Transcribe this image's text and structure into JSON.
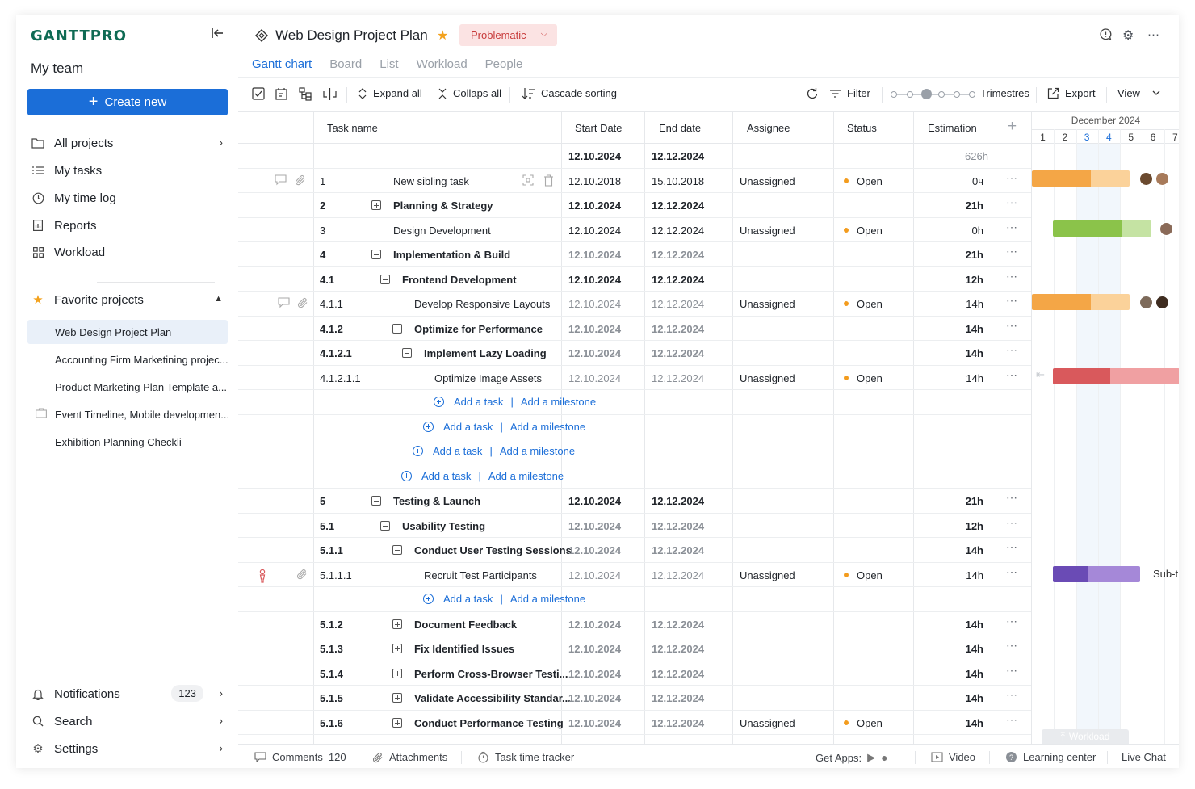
{
  "app": {
    "logo": "GANTTPRO"
  },
  "sidebar": {
    "team": "My team",
    "create_label": "Create new",
    "nav": [
      {
        "label": "All projects",
        "icon": "folder-icon"
      },
      {
        "label": "My tasks",
        "icon": "list-icon"
      },
      {
        "label": "My time log",
        "icon": "clock-icon"
      },
      {
        "label": "Reports",
        "icon": "report-icon"
      },
      {
        "label": "Workload",
        "icon": "grid-icon"
      }
    ],
    "favorites_label": "Favorite projects",
    "favorites": [
      "Web Design Project Plan",
      "Accounting Firm Marketining projec...",
      "Product Marketing Plan Template a...",
      "Event Timeline, Mobile developmen...",
      "Exhibition Planning Checkli"
    ],
    "bottom": [
      {
        "label": "Notifications",
        "count": "123"
      },
      {
        "label": "Search"
      },
      {
        "label": "Settings"
      }
    ]
  },
  "header": {
    "title": "Web Design Project Plan",
    "status": "Problematic",
    "tabs": [
      "Gantt chart",
      "Board",
      "List",
      "Workload",
      "People"
    ]
  },
  "toolbar": {
    "expand": "Expand all",
    "collapse": "Collaps all",
    "cascade": "Cascade sorting",
    "filter": "Filter",
    "scale": "Trimestres",
    "export": "Export",
    "view": "View"
  },
  "grid": {
    "columns": [
      "Task name",
      "Start Date",
      "End date",
      "Assignee",
      "Status",
      "Estimation"
    ],
    "summary": {
      "start": "12.10.2024",
      "end": "12.12.2024",
      "estimation": "626h"
    },
    "rows": [
      {
        "type": "task",
        "num": "1",
        "name": "New sibling task",
        "start": "12.10.2018",
        "end": "15.10.2018",
        "assignee": "Unassigned",
        "status": "Open",
        "est": "0ч",
        "bold": false,
        "muted": false,
        "level": 0,
        "expand": ""
      },
      {
        "type": "task",
        "num": "2",
        "name": "Planning & Strategy",
        "start": "12.10.2024",
        "end": "12.12.2024",
        "assignee": "",
        "status": "",
        "est": "21h",
        "bold": true,
        "muted": false,
        "level": 0,
        "expand": "plus"
      },
      {
        "type": "task",
        "num": "3",
        "name": "Design Development",
        "start": "12.10.2024",
        "end": "12.12.2024",
        "assignee": "Unassigned",
        "status": "Open",
        "est": "0h",
        "bold": false,
        "muted": false,
        "level": 0,
        "expand": ""
      },
      {
        "type": "task",
        "num": "4",
        "name": "Implementation & Build",
        "start": "12.10.2024",
        "end": "12.12.2024",
        "assignee": "",
        "status": "",
        "est": "21h",
        "bold": true,
        "muted": true,
        "level": 0,
        "expand": "minus"
      },
      {
        "type": "task",
        "num": "4.1",
        "name": "Frontend Development",
        "start": "12.10.2024",
        "end": "12.12.2024",
        "assignee": "",
        "status": "",
        "est": "12h",
        "bold": true,
        "muted": false,
        "level": 1,
        "expand": "minus"
      },
      {
        "type": "task",
        "num": "4.1.1",
        "name": "Develop Responsive Layouts",
        "start": "12.10.2024",
        "end": "12.12.2024",
        "assignee": "Unassigned",
        "status": "Open",
        "est": "14h",
        "bold": false,
        "muted": true,
        "level": 2,
        "expand": ""
      },
      {
        "type": "task",
        "num": "4.1.2",
        "name": "Optimize for Performance",
        "start": "12.10.2024",
        "end": "12.12.2024",
        "assignee": "",
        "status": "",
        "est": "14h",
        "bold": true,
        "muted": true,
        "level": 2,
        "expand": "minus"
      },
      {
        "type": "task",
        "num": "4.1.2.1",
        "name": "Implement Lazy Loading",
        "start": "12.10.2024",
        "end": "12.12.2024",
        "assignee": "",
        "status": "",
        "est": "14h",
        "bold": true,
        "muted": true,
        "level": 3,
        "expand": "minus"
      },
      {
        "type": "task",
        "num": "4.1.2.1.1",
        "name": "Optimize Image Assets",
        "start": "12.10.2024",
        "end": "12.12.2024",
        "assignee": "Unassigned",
        "status": "Open",
        "est": "14h",
        "bold": false,
        "muted": true,
        "level": 4,
        "expand": ""
      },
      {
        "type": "add",
        "level": 4
      },
      {
        "type": "add",
        "level": 3
      },
      {
        "type": "add",
        "level": 2
      },
      {
        "type": "add",
        "level": 1
      },
      {
        "type": "task",
        "num": "5",
        "name": "Testing & Launch",
        "start": "12.10.2024",
        "end": "12.12.2024",
        "assignee": "",
        "status": "",
        "est": "21h",
        "bold": true,
        "muted": false,
        "level": 0,
        "expand": "minus"
      },
      {
        "type": "task",
        "num": "5.1",
        "name": "Usability Testing",
        "start": "12.10.2024",
        "end": "12.12.2024",
        "assignee": "",
        "status": "",
        "est": "12h",
        "bold": true,
        "muted": true,
        "level": 1,
        "expand": "minus"
      },
      {
        "type": "task",
        "num": "5.1.1",
        "name": "Conduct User Testing Sessions",
        "start": "12.10.2024",
        "end": "12.12.2024",
        "assignee": "",
        "status": "",
        "est": "14h",
        "bold": true,
        "muted": true,
        "level": 2,
        "expand": "minus"
      },
      {
        "type": "task",
        "num": "5.1.1.1",
        "name": "Recruit Test Participants",
        "start": "12.10.2024",
        "end": "12.12.2024",
        "assignee": "Unassigned",
        "status": "Open",
        "est": "14h",
        "bold": false,
        "muted": true,
        "level": 3,
        "expand": ""
      },
      {
        "type": "add",
        "level": 3
      },
      {
        "type": "task",
        "num": "5.1.2",
        "name": "Document Feedback",
        "start": "12.10.2024",
        "end": "12.12.2024",
        "assignee": "",
        "status": "",
        "est": "14h",
        "bold": true,
        "muted": true,
        "level": 2,
        "expand": "plus"
      },
      {
        "type": "task",
        "num": "5.1.3",
        "name": "Fix Identified Issues",
        "start": "12.10.2024",
        "end": "12.12.2024",
        "assignee": "",
        "status": "",
        "est": "14h",
        "bold": true,
        "muted": true,
        "level": 2,
        "expand": "plus"
      },
      {
        "type": "task",
        "num": "5.1.4",
        "name": "Perform Cross-Browser Testi...",
        "start": "12.10.2024",
        "end": "12.12.2024",
        "assignee": "",
        "status": "",
        "est": "14h",
        "bold": true,
        "muted": true,
        "level": 2,
        "expand": "plus"
      },
      {
        "type": "task",
        "num": "5.1.5",
        "name": "Validate Accessibility Standar...",
        "start": "12.10.2024",
        "end": "12.12.2024",
        "assignee": "",
        "status": "",
        "est": "14h",
        "bold": true,
        "muted": true,
        "level": 2,
        "expand": "plus"
      },
      {
        "type": "task",
        "num": "5.1.6",
        "name": "Conduct Performance Testing",
        "start": "12.10.2024",
        "end": "12.12.2024",
        "assignee": "Unassigned",
        "status": "Open",
        "est": "14h",
        "bold": true,
        "muted": true,
        "level": 2,
        "expand": "plus"
      }
    ],
    "add_task": "Add a task",
    "add_milestone": "Add a milestone"
  },
  "gantt": {
    "month": "December 2024",
    "days": [
      "1",
      "2",
      "3",
      "4",
      "5",
      "6",
      "7"
    ],
    "highlight_days": [
      "3",
      "4"
    ],
    "label_sub": "Sub-t",
    "workload_chip": "Workload"
  },
  "footer": {
    "comments": "Comments",
    "comments_count": "120",
    "attachments": "Attachments",
    "tracker": "Task time tracker",
    "get_apps": "Get Apps:",
    "video": "Video",
    "learning": "Learning center",
    "chat": "Live Chat"
  },
  "colors": {
    "accent": "#1b6ed8",
    "brand": "#0f6b54",
    "status_open": "#f39c1e",
    "problematic_bg": "#fbe3e3"
  }
}
